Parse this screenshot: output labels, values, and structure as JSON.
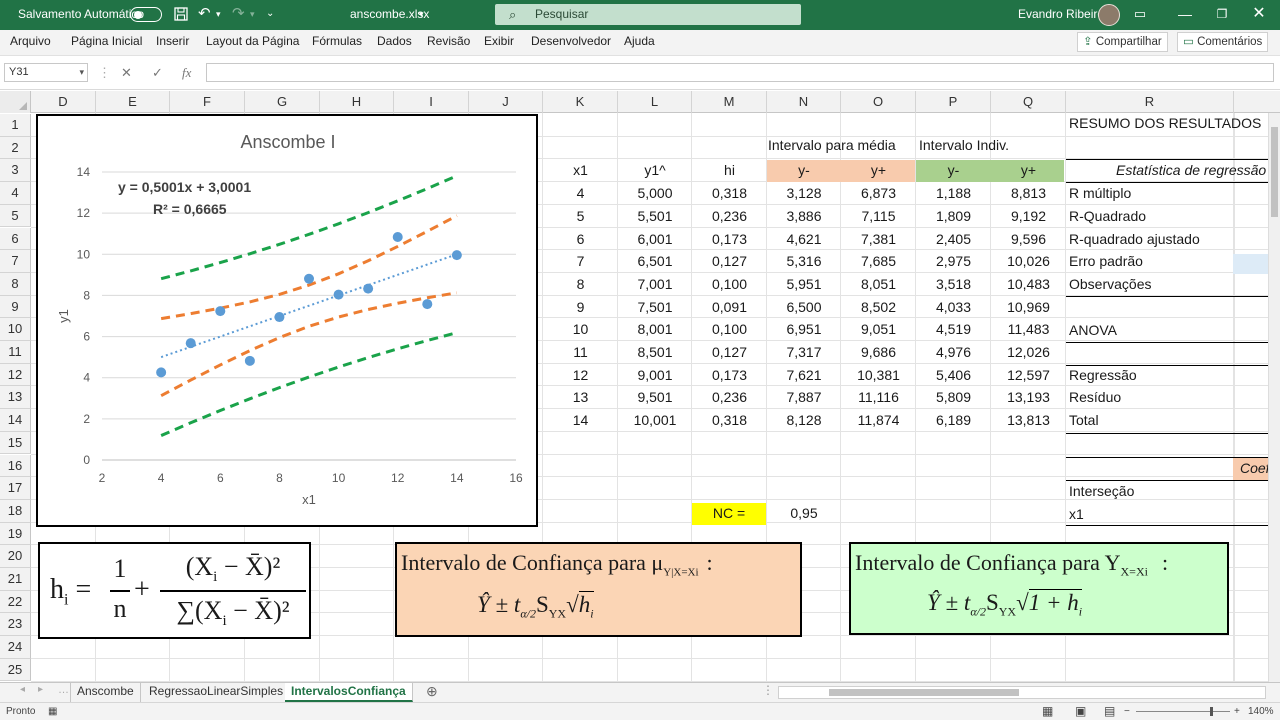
{
  "titlebar": {
    "autosave_label": "Salvamento Automático",
    "file_name": "anscombe.xlsx",
    "search_placeholder": "Pesquisar",
    "user_name": "Evandro Ribeiro"
  },
  "menu": [
    "Arquivo",
    "Página Inicial",
    "Inserir",
    "Layout da Página",
    "Fórmulas",
    "Dados",
    "Revisão",
    "Exibir",
    "Desenvolvedor",
    "Ajuda"
  ],
  "share": {
    "share_label": "Compartilhar",
    "comments_label": "Comentários"
  },
  "formula_bar": {
    "name_box": "Y31",
    "cancel": "✕",
    "enter": "✓",
    "fx": "fx",
    "content": ""
  },
  "columns": [
    "D",
    "E",
    "F",
    "G",
    "H",
    "I",
    "J",
    "K",
    "L",
    "M",
    "N",
    "O",
    "P",
    "Q",
    "R"
  ],
  "rows": [
    "1",
    "2",
    "3",
    "4",
    "5",
    "6",
    "7",
    "8",
    "9",
    "10",
    "11",
    "12",
    "13",
    "14",
    "15",
    "16",
    "17",
    "18",
    "19",
    "20",
    "21",
    "22",
    "23",
    "24",
    "25"
  ],
  "table": {
    "header_intervalo_media": "Intervalo para média",
    "header_intervalo_indiv": "Intervalo Indiv.",
    "col_headers": [
      "x1",
      "y1^",
      "hi",
      "y-",
      "y+",
      "y-",
      "y+"
    ],
    "rows": [
      [
        "4",
        "5,000",
        "0,318",
        "3,128",
        "6,873",
        "1,188",
        "8,813"
      ],
      [
        "5",
        "5,501",
        "0,236",
        "3,886",
        "7,115",
        "1,809",
        "9,192"
      ],
      [
        "6",
        "6,001",
        "0,173",
        "4,621",
        "7,381",
        "2,405",
        "9,596"
      ],
      [
        "7",
        "6,501",
        "0,127",
        "5,316",
        "7,685",
        "2,975",
        "10,026"
      ],
      [
        "8",
        "7,001",
        "0,100",
        "5,951",
        "8,051",
        "3,518",
        "10,483"
      ],
      [
        "9",
        "7,501",
        "0,091",
        "6,500",
        "8,502",
        "4,033",
        "10,969"
      ],
      [
        "10",
        "8,001",
        "0,100",
        "6,951",
        "9,051",
        "4,519",
        "11,483"
      ],
      [
        "11",
        "8,501",
        "0,127",
        "7,317",
        "9,686",
        "4,976",
        "12,026"
      ],
      [
        "12",
        "9,001",
        "0,173",
        "7,621",
        "10,381",
        "5,406",
        "12,597"
      ],
      [
        "13",
        "9,501",
        "0,236",
        "7,887",
        "11,116",
        "5,809",
        "13,193"
      ],
      [
        "14",
        "10,001",
        "0,318",
        "8,128",
        "11,874",
        "6,189",
        "13,813"
      ]
    ],
    "nc_label": "NC =",
    "nc_value": "0,95"
  },
  "summary": {
    "title": "RESUMO DOS RESULTADOS",
    "stat_header": "Estatística de regressão",
    "items": [
      "R múltiplo",
      "R-Quadrado",
      "R-quadrado ajustado",
      "Erro padrão",
      "Observações"
    ],
    "anova": "ANOVA",
    "anova_items": [
      "Regressão",
      "Resíduo",
      "Total"
    ],
    "coef_header": "Coeficientes",
    "coef_items": [
      "Interseção",
      "x1"
    ]
  },
  "formulas": {
    "h_lhs": "h",
    "h_sub": "i",
    "h_num_one": "1",
    "h_den_n": "n",
    "h_frac_num": "(X",
    "h_frac_num_sub": "i",
    "h_frac_num_rest": " − X̄)²",
    "h_frac_den": "∑(X",
    "h_frac_den_sub": "i",
    "h_frac_den_rest": " − X̄)²",
    "ic_media_title": "Intervalo de Confiança  para μ",
    "ic_media_sub": "Y|X=Xi",
    "ic_media_expr": "Ŷ ± t",
    "ic_media_expr_sub": "α/2",
    "ic_media_sxy": "S",
    "ic_media_sxy_sub": "YX",
    "ic_media_root": "h",
    "ic_media_root_sub": "i",
    "ic_indiv_title": "Intervalo de Confiança para Y",
    "ic_indiv_sub": "X=Xi",
    "ic_indiv_expr": "Ŷ ± t",
    "ic_indiv_expr_sub": "α/2",
    "ic_indiv_sxy": "S",
    "ic_indiv_sxy_sub": "YX",
    "ic_indiv_root": "1 + h",
    "ic_indiv_root_sub": "i",
    "colon": ":"
  },
  "sheets": [
    "Anscombe",
    "RegressaoLinearSimples",
    "IntervalosConfiança"
  ],
  "active_sheet": 2,
  "status": {
    "ready": "Pronto",
    "zoom": "140%"
  },
  "colors": {
    "excel_green": "#217346",
    "salmon": "#f8cbad",
    "green_fill": "#a9d08e",
    "yellow": "#ffff00"
  },
  "chart_data": {
    "type": "scatter",
    "title": "Anscombe I",
    "xlabel": "x1",
    "ylabel": "y1",
    "xlim": [
      2,
      16
    ],
    "ylim": [
      0,
      14
    ],
    "xticks": [
      2,
      4,
      6,
      8,
      10,
      12,
      14,
      16
    ],
    "yticks": [
      0,
      2,
      4,
      6,
      8,
      10,
      12,
      14
    ],
    "equation": "y = 0,5001x + 3,0001",
    "r2": "R² = 0,6665",
    "points": [
      [
        10,
        8.04
      ],
      [
        8,
        6.95
      ],
      [
        13,
        7.58
      ],
      [
        9,
        8.81
      ],
      [
        11,
        8.33
      ],
      [
        14,
        9.96
      ],
      [
        6,
        7.24
      ],
      [
        4,
        4.26
      ],
      [
        12,
        10.84
      ],
      [
        7,
        4.82
      ],
      [
        5,
        5.68
      ]
    ],
    "trendline": {
      "slope": 0.5001,
      "intercept": 3.0001
    },
    "bands": [
      {
        "name": "y-",
        "color": "#ed7d31",
        "x": [
          4,
          5,
          6,
          7,
          8,
          9,
          10,
          11,
          12,
          13,
          14
        ],
        "y": [
          3.128,
          3.886,
          4.621,
          5.316,
          5.951,
          6.5,
          6.951,
          7.317,
          7.621,
          7.887,
          8.128
        ]
      },
      {
        "name": "y+",
        "color": "#ed7d31",
        "x": [
          4,
          5,
          6,
          7,
          8,
          9,
          10,
          11,
          12,
          13,
          14
        ],
        "y": [
          6.873,
          7.115,
          7.381,
          7.685,
          8.051,
          8.502,
          9.051,
          9.686,
          10.381,
          11.116,
          11.874
        ]
      },
      {
        "name": "y-",
        "color": "#1aa34a",
        "x": [
          4,
          5,
          6,
          7,
          8,
          9,
          10,
          11,
          12,
          13,
          14
        ],
        "y": [
          1.188,
          1.809,
          2.405,
          2.975,
          3.518,
          4.033,
          4.519,
          4.976,
          5.406,
          5.809,
          6.189
        ]
      },
      {
        "name": "y+",
        "color": "#1aa34a",
        "x": [
          4,
          5,
          6,
          7,
          8,
          9,
          10,
          11,
          12,
          13,
          14
        ],
        "y": [
          8.813,
          9.192,
          9.596,
          10.026,
          10.483,
          10.969,
          11.483,
          12.026,
          12.597,
          13.193,
          13.813
        ]
      }
    ],
    "point_color": "#5b9bd5",
    "grid": true
  }
}
